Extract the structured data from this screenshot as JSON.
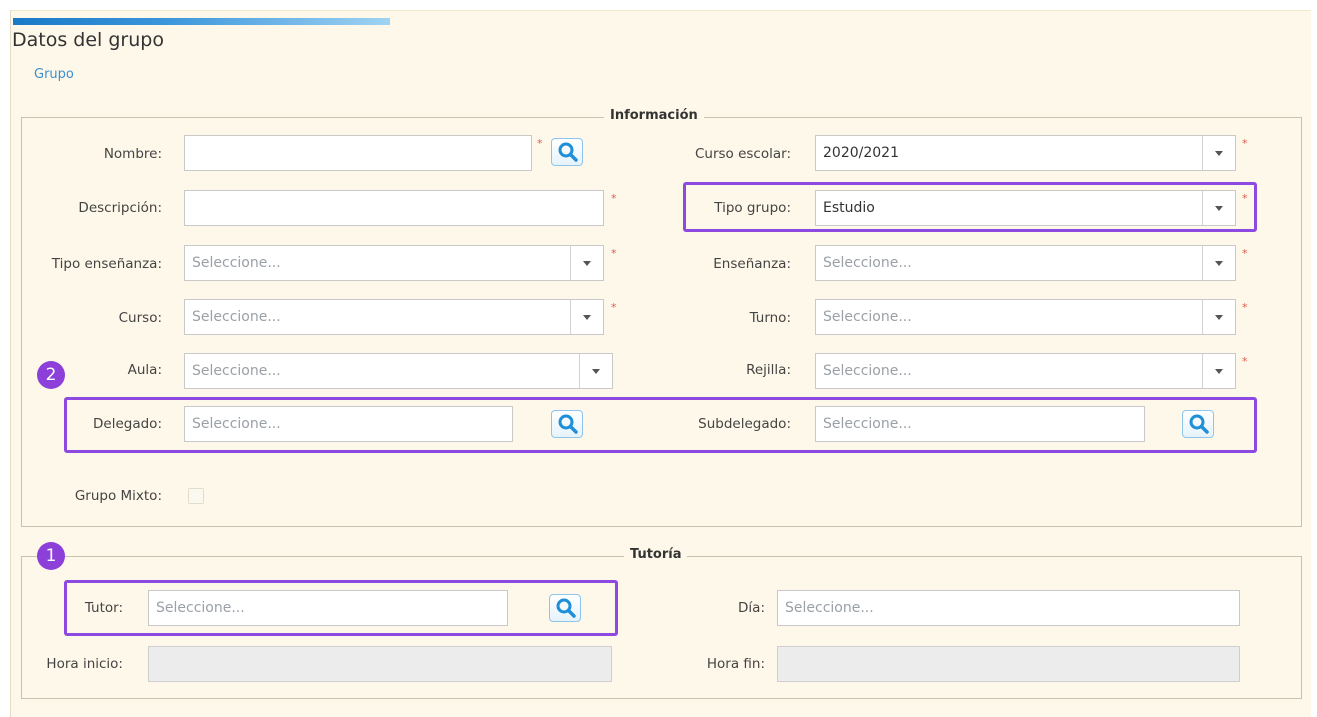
{
  "header": {
    "title": "Datos del grupo",
    "breadcrumb": "Grupo"
  },
  "informacion": {
    "legend": "Información",
    "nombre": {
      "label": "Nombre:",
      "value": ""
    },
    "descripcion": {
      "label": "Descripción:",
      "value": ""
    },
    "tipo_ensenanza": {
      "label": "Tipo enseñanza:",
      "value": "Seleccione..."
    },
    "curso": {
      "label": "Curso:",
      "value": "Seleccione..."
    },
    "aula": {
      "label": "Aula:",
      "value": "Seleccione..."
    },
    "delegado": {
      "label": "Delegado:",
      "placeholder": "Seleccione..."
    },
    "grupo_mixto": {
      "label": "Grupo Mixto:",
      "checked": false
    },
    "curso_escolar": {
      "label": "Curso escolar:",
      "value": "2020/2021"
    },
    "tipo_grupo": {
      "label": "Tipo grupo:",
      "value": "Estudio"
    },
    "ensenanza": {
      "label": "Enseñanza:",
      "value": "Seleccione..."
    },
    "turno": {
      "label": "Turno:",
      "value": "Seleccione..."
    },
    "rejilla": {
      "label": "Rejilla:",
      "value": "Seleccione..."
    },
    "subdelegado": {
      "label": "Subdelegado:",
      "placeholder": "Seleccione..."
    }
  },
  "tutoria": {
    "legend": "Tutoría",
    "tutor": {
      "label": "Tutor:",
      "placeholder": "Seleccione..."
    },
    "hora_inicio": {
      "label": "Hora inicio:",
      "value": ""
    },
    "dia": {
      "label": "Día:",
      "placeholder": "Seleccione..."
    },
    "hora_fin": {
      "label": "Hora fin:",
      "value": ""
    }
  },
  "annotations": {
    "step1": "1",
    "step2": "2"
  },
  "required_mark": "*",
  "icons": {
    "search": "search-icon",
    "dropdown": "chevron-down-icon"
  },
  "colors": {
    "accent": "#8d49e0",
    "link": "#3b8fd0",
    "required": "#e25a4f",
    "search_icon": "#1f8fd6",
    "background": "#fdf8e9"
  }
}
